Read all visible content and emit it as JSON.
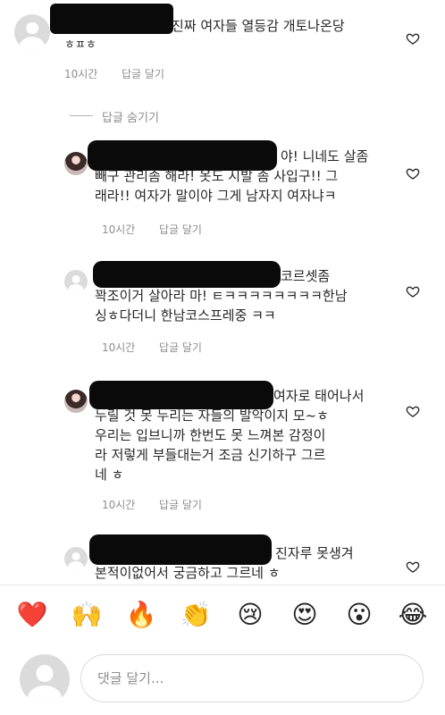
{
  "comments": [
    {
      "lines": [
        "진짜 여자들 열등감 개토나온당",
        "ㅎㅍㅎ"
      ],
      "time": "10시간",
      "reply": "답글 달기"
    },
    {
      "lines": [
        "야! 니네도 살좀",
        "빼구 관리좀 해라! 옷도 시발 좀 사입구!! 그",
        "래라!! 여자가 말이야 그게 남자지 여자냐ㅋ"
      ],
      "time": "10시간",
      "reply": "답글 달기"
    },
    {
      "lines": [
        "코르셋좀",
        "꽉조이거 살아라 마! ㅌㅋㅋㅋㅋㅋㅋㅋㅋ한남",
        "싱ㅎ다더니 한남코스프레중 ㅋㅋ"
      ],
      "time": "10시간",
      "reply": "답글 달기"
    },
    {
      "lines": [
        "여자로 태어나서",
        "누릴 것 못 누리는 자들의 발악이지 모~ㅎ",
        "우리는 입브니까 한번도 못 느껴본 감정이",
        "라 저렇게 부들대는거 조금 신기하구 그르",
        "네 ㅎ"
      ],
      "time": "10시간",
      "reply": "답글 달기"
    },
    {
      "lines": [
        "진자루 못생겨",
        "본적이없어서 궁금하고 그르네 ㅎ"
      ]
    }
  ],
  "hide_replies": "답글 숨기기",
  "emojis": [
    "❤️",
    "🙌",
    "🔥",
    "👏",
    "😢",
    "😍",
    "😮",
    "😂"
  ],
  "input": {
    "placeholder": "댓글 달기..."
  },
  "colors": {
    "text": "#262626",
    "meta": "#8e8e8e",
    "heart_outline": "#262626"
  }
}
